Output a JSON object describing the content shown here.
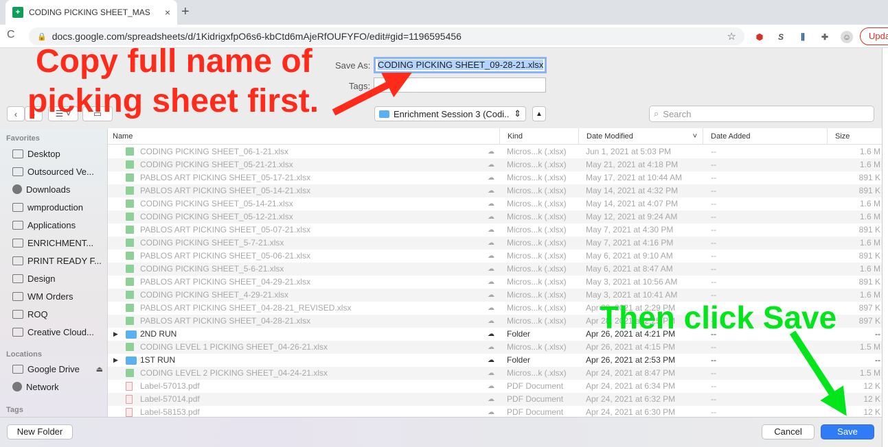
{
  "browser": {
    "tab_title": "CODING PICKING SHEET_MAS",
    "tab_close": "×",
    "new_tab": "+",
    "reload": "C",
    "lock": "🔒",
    "url": "docs.google.com/spreadsheets/d/1KidrigxfpO6s6-kbCtd6mAjeRfOUFYFO/edit#gid=1196595456",
    "update_label": "Upda"
  },
  "dialog": {
    "save_as_label": "Save As:",
    "save_as_value": "CODING PICKING SHEET_09-28-21.xlsx",
    "tags_label": "Tags:",
    "folder_name": "Enrichment Session 3 (Codi...",
    "search_placeholder": "Search",
    "columns": {
      "name": "Name",
      "kind": "Kind",
      "date_modified": "Date Modified",
      "date_added": "Date Added",
      "size": "Size"
    },
    "new_folder_label": "New Folder",
    "cancel_label": "Cancel",
    "save_label": "Save"
  },
  "sidebar": {
    "favorites_header": "Favorites",
    "favorites": [
      {
        "label": "Desktop",
        "icon": "desktop-icon"
      },
      {
        "label": "Outsourced Ve...",
        "icon": "folder-icon"
      },
      {
        "label": "Downloads",
        "icon": "downloads-icon"
      },
      {
        "label": "wmproduction",
        "icon": "home-icon"
      },
      {
        "label": "Applications",
        "icon": "applications-icon"
      },
      {
        "label": "ENRICHMENT...",
        "icon": "folder-icon"
      },
      {
        "label": "PRINT READY F...",
        "icon": "folder-icon"
      },
      {
        "label": "Design",
        "icon": "folder-icon"
      },
      {
        "label": "WM Orders",
        "icon": "folder-icon"
      },
      {
        "label": "ROQ",
        "icon": "folder-icon"
      },
      {
        "label": "Creative Cloud...",
        "icon": "folder-icon"
      }
    ],
    "locations_header": "Locations",
    "locations": [
      {
        "label": "Google Drive",
        "icon": "drive-icon"
      },
      {
        "label": "Network",
        "icon": "network-icon"
      }
    ],
    "tags_header": "Tags"
  },
  "files": [
    {
      "name": "CODING PICKING SHEET_06-1-21.xlsx",
      "kind": "Micros...k (.xlsx)",
      "date": "Jun 1, 2021 at 5:03 PM",
      "added": "--",
      "size": "1.6 M",
      "type": "xls",
      "enabled": false
    },
    {
      "name": "CODING PICKING SHEET_05-21-21.xlsx",
      "kind": "Micros...k (.xlsx)",
      "date": "May 21, 2021 at 4:18 PM",
      "added": "--",
      "size": "1.6 M",
      "type": "xls",
      "enabled": false
    },
    {
      "name": "PABLOS ART PICKING SHEET_05-17-21.xlsx",
      "kind": "Micros...k (.xlsx)",
      "date": "May 17, 2021 at 10:44 AM",
      "added": "--",
      "size": "891 K",
      "type": "xls",
      "enabled": false
    },
    {
      "name": "PABLOS ART PICKING SHEET_05-14-21.xlsx",
      "kind": "Micros...k (.xlsx)",
      "date": "May 14, 2021 at 4:32 PM",
      "added": "--",
      "size": "891 K",
      "type": "xls",
      "enabled": false
    },
    {
      "name": "CODING PICKING SHEET_05-14-21.xlsx",
      "kind": "Micros...k (.xlsx)",
      "date": "May 14, 2021 at 4:07 PM",
      "added": "--",
      "size": "1.6 M",
      "type": "xls",
      "enabled": false
    },
    {
      "name": "CODING PICKING SHEET_05-12-21.xlsx",
      "kind": "Micros...k (.xlsx)",
      "date": "May 12, 2021 at 9:24 AM",
      "added": "--",
      "size": "1.6 M",
      "type": "xls",
      "enabled": false
    },
    {
      "name": "PABLOS ART PICKING SHEET_05-07-21.xlsx",
      "kind": "Micros...k (.xlsx)",
      "date": "May 7, 2021 at 4:30 PM",
      "added": "--",
      "size": "891 K",
      "type": "xls",
      "enabled": false
    },
    {
      "name": "CODING PICKING SHEET_5-7-21.xlsx",
      "kind": "Micros...k (.xlsx)",
      "date": "May 7, 2021 at 4:16 PM",
      "added": "--",
      "size": "1.6 M",
      "type": "xls",
      "enabled": false
    },
    {
      "name": "PABLOS ART PICKING SHEET_05-06-21.xlsx",
      "kind": "Micros...k (.xlsx)",
      "date": "May 6, 2021 at 9:10 AM",
      "added": "--",
      "size": "891 K",
      "type": "xls",
      "enabled": false
    },
    {
      "name": "CODING PICKING SHEET_5-6-21.xlsx",
      "kind": "Micros...k (.xlsx)",
      "date": "May 6, 2021 at 8:47 AM",
      "added": "--",
      "size": "1.6 M",
      "type": "xls",
      "enabled": false
    },
    {
      "name": "PABLOS ART PICKING SHEET_04-29-21.xlsx",
      "kind": "Micros...k (.xlsx)",
      "date": "May 3, 2021 at 10:56 AM",
      "added": "--",
      "size": "891 K",
      "type": "xls",
      "enabled": false
    },
    {
      "name": "CODING PICKING SHEET_4-29-21.xlsx",
      "kind": "Micros...k (.xlsx)",
      "date": "May 3, 2021 at 10:41 AM",
      "added": "--",
      "size": "1.6 M",
      "type": "xls",
      "enabled": false
    },
    {
      "name": "PABLOS ART PICKING SHEET_04-28-21_REVISED.xlsx",
      "kind": "Micros...k (.xlsx)",
      "date": "Apr 28, 2021 at 2:29 PM",
      "added": "--",
      "size": "897 K",
      "type": "xls",
      "enabled": false
    },
    {
      "name": "PABLOS ART PICKING SHEET_04-28-21.xlsx",
      "kind": "Micros...k (.xlsx)",
      "date": "Apr 28, 2021 at 2:25 PM",
      "added": "--",
      "size": "897 K",
      "type": "xls",
      "enabled": false
    },
    {
      "name": "2ND RUN",
      "kind": "Folder",
      "date": "Apr 26, 2021 at 4:21 PM",
      "added": "--",
      "size": "--",
      "type": "folder",
      "enabled": true
    },
    {
      "name": "CODING LEVEL 1 PICKING SHEET_04-26-21.xlsx",
      "kind": "Micros...k (.xlsx)",
      "date": "Apr 26, 2021 at 4:15 PM",
      "added": "--",
      "size": "1.5 M",
      "type": "xls",
      "enabled": false
    },
    {
      "name": "1ST RUN",
      "kind": "Folder",
      "date": "Apr 26, 2021 at 2:53 PM",
      "added": "--",
      "size": "--",
      "type": "folder",
      "enabled": true
    },
    {
      "name": "CODING LEVEL 2 PICKING SHEET_04-24-21.xlsx",
      "kind": "Micros...k (.xlsx)",
      "date": "Apr 24, 2021 at 8:47 PM",
      "added": "--",
      "size": "1.5 M",
      "type": "xls",
      "enabled": false
    },
    {
      "name": "Label-57013.pdf",
      "kind": "PDF Document",
      "date": "Apr 24, 2021 at 6:34 PM",
      "added": "--",
      "size": "12 K",
      "type": "pdf",
      "enabled": false
    },
    {
      "name": "Label-57014.pdf",
      "kind": "PDF Document",
      "date": "Apr 24, 2021 at 6:32 PM",
      "added": "--",
      "size": "12 K",
      "type": "pdf",
      "enabled": false
    },
    {
      "name": "Label-58153.pdf",
      "kind": "PDF Document",
      "date": "Apr 24, 2021 at 6:30 PM",
      "added": "--",
      "size": "12 K",
      "type": "pdf",
      "enabled": false
    }
  ],
  "annotations": {
    "copy_line1": "Copy full name of",
    "copy_line2": "picking sheet first.",
    "then_click": "Then click Save",
    "red": "#ff2a1a",
    "green": "#00e61a"
  },
  "colors": {
    "accent": "#2f7cf6",
    "selection": "#b3d4fd",
    "sheets_green": "#0f9d58"
  }
}
